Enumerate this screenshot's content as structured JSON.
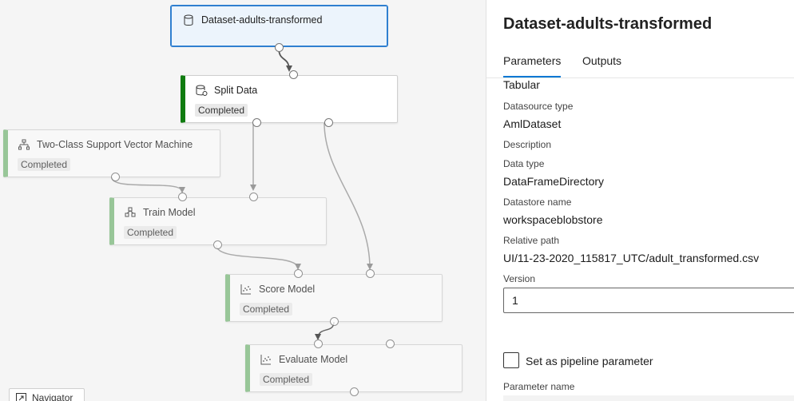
{
  "canvas": {
    "nodes": {
      "dataset": {
        "title": "Dataset-adults-transformed",
        "icon": "database-icon"
      },
      "split": {
        "title": "Split Data",
        "status": "Completed",
        "icon": "split-data-icon"
      },
      "svm": {
        "title": "Two-Class Support Vector Machine",
        "status": "Completed",
        "icon": "hierarchy-icon"
      },
      "train": {
        "title": "Train Model",
        "status": "Completed",
        "icon": "train-model-icon"
      },
      "score": {
        "title": "Score Model",
        "status": "Completed",
        "icon": "scatter-icon"
      },
      "evaluate": {
        "title": "Evaluate Model",
        "status": "Completed",
        "icon": "scatter-icon"
      }
    },
    "navigator": {
      "label": "Navigator",
      "icon": "expand-icon"
    },
    "colors": {
      "completed_bar": "#107c10",
      "completed_bar_faded": "#7fba7f",
      "selected_border": "#2f7fd0"
    }
  },
  "panel": {
    "title": "Dataset-adults-transformed",
    "tabs": {
      "parameters": "Parameters",
      "outputs": "Outputs"
    },
    "fields": {
      "type_value": "Tabular",
      "datasource_type_label": "Datasource type",
      "datasource_type_value": "AmlDataset",
      "description_label": "Description",
      "data_type_label": "Data type",
      "data_type_value": "DataFrameDirectory",
      "datastore_name_label": "Datastore name",
      "datastore_name_value": "workspaceblobstore",
      "relative_path_label": "Relative path",
      "relative_path_value": "UI/11-23-2020_115817_UTC/adult_transformed.csv",
      "version_label": "Version",
      "version_value": "1"
    },
    "pipeline_parameter": {
      "label": "Set as pipeline parameter",
      "checked": false
    },
    "parameter_name_label": "Parameter name",
    "colors": {
      "tab_underline": "#0078d4"
    }
  }
}
